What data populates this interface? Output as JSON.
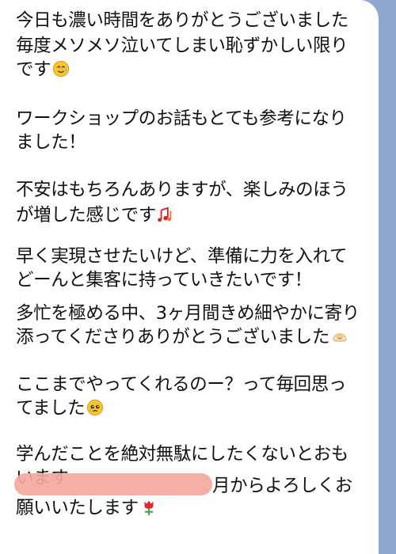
{
  "message": {
    "lines": [
      "今日も濃い時間をありがとうございました",
      "毎度メソメソ泣いてしまい恥ずかしい限り",
      "です",
      "ワークショップのお話もとても参考になり",
      "ました！",
      "不安はもちろんありますが、楽しみのほう",
      "が増した感じです",
      "早く実現させたいけど、準備に力を入れて",
      "どーんと集客に持っていきたいです！",
      "多忙を極める中、3ヶ月間きめ細やかに寄り",
      "添ってくださりありがとうございました",
      "ここまでやってくれるのー？って毎回思っ",
      "てました",
      "学んだことを絶対無駄にしたくないとおも",
      "います",
      "月からよろしくお",
      "願いいたします"
    ],
    "emoji": {
      "line3": "tear-smile-emoji",
      "line7": "music-notes-emoji",
      "line11": "bowing-emoji",
      "line13": "teary-face-emoji",
      "line17": "tulip-emoji"
    },
    "redaction_color": "#f3a8a0"
  },
  "background_color": "#8ea7cf"
}
